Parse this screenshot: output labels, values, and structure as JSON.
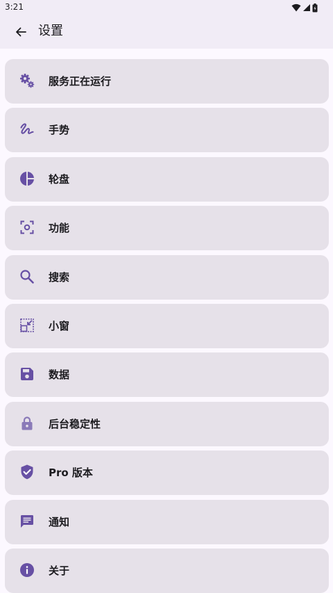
{
  "status_bar": {
    "time": "3:21"
  },
  "app_bar": {
    "title": "设置"
  },
  "colors": {
    "accent": "#6750a4",
    "card_bg": "#e6e1e9",
    "bar_bg": "#f1ecf6"
  },
  "settings": [
    {
      "id": "service",
      "label": "服务正在运行",
      "icon": "gears-icon"
    },
    {
      "id": "gesture",
      "label": "手势",
      "icon": "gesture-icon"
    },
    {
      "id": "wheel",
      "label": "轮盘",
      "icon": "pie-chart-icon"
    },
    {
      "id": "function",
      "label": "功能",
      "icon": "screenshot-frame-icon"
    },
    {
      "id": "search",
      "label": "搜索",
      "icon": "search-icon"
    },
    {
      "id": "window",
      "label": "小窗",
      "icon": "picture-in-picture-icon"
    },
    {
      "id": "data",
      "label": "数据",
      "icon": "save-icon"
    },
    {
      "id": "background",
      "label": "后台稳定性",
      "icon": "lock-icon"
    },
    {
      "id": "pro",
      "label": "Pro 版本",
      "icon": "shield-check-icon"
    },
    {
      "id": "notification",
      "label": "通知",
      "icon": "message-icon"
    },
    {
      "id": "about",
      "label": "关于",
      "icon": "info-icon"
    }
  ]
}
